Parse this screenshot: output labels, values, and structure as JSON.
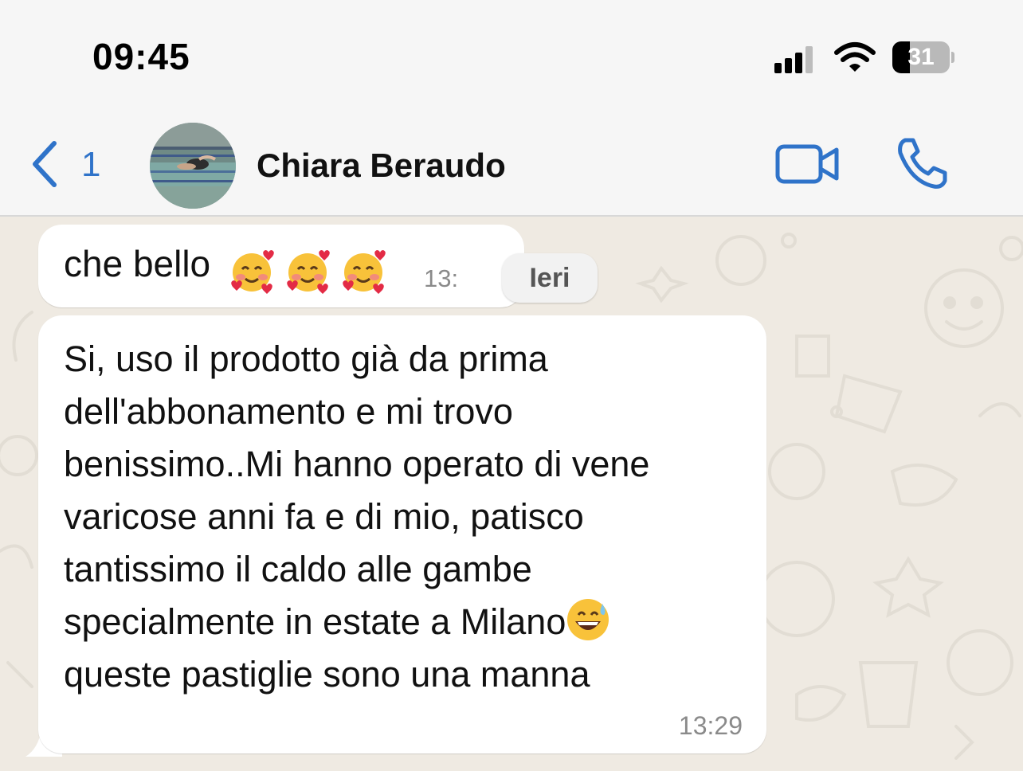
{
  "status_bar": {
    "time": "09:45",
    "battery_level": "31",
    "battery_fraction": 0.31,
    "signal_bars": 3,
    "icons": [
      "cellular-signal-icon",
      "wifi-icon",
      "battery-icon"
    ]
  },
  "header": {
    "back_count": "1",
    "contact_name": "Chiara Beraudo",
    "icons": [
      "back-chevron-icon",
      "video-call-icon",
      "phone-icon"
    ],
    "accent_color": "#2f73c9"
  },
  "messages": [
    {
      "text": "che bello",
      "emojis": [
        "smiling-face-with-hearts",
        "smiling-face-with-hearts",
        "smiling-face-with-hearts"
      ],
      "time": "13:",
      "date_badge": "Ieri"
    },
    {
      "lines": [
        "Si, uso il prodotto già da prima",
        "dell'abbonamento e mi trovo",
        "benissimo..Mi hanno operato di vene",
        "varicose anni fa e di mio, patisco",
        "tantissimo il caldo alle gambe",
        "specialmente in estate a Milano",
        "queste pastiglie sono una manna"
      ],
      "inline_emoji": "grinning-face-with-sweat",
      "time": "13:29"
    }
  ],
  "colors": {
    "chat_background": "#efeae2",
    "bubble": "#ffffff",
    "header_background": "#f6f6f6"
  }
}
